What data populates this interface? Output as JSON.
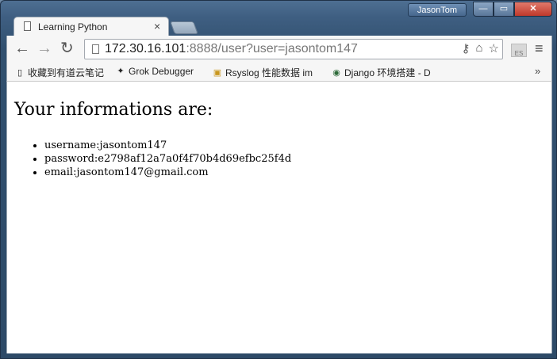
{
  "window": {
    "user_badge": "JasonTom",
    "buttons": {
      "minimize": "—",
      "maximize": "▭",
      "close": "✕"
    }
  },
  "tab": {
    "title": "Learning Python",
    "close": "×"
  },
  "toolbar": {
    "back": "←",
    "forward": "→",
    "reload": "↻",
    "url_host": "172.30.16.101",
    "url_rest": ":8888/user?user=jasontom147",
    "extension_label": "ES",
    "menu": "≡"
  },
  "bookmarks": {
    "items": [
      {
        "label": "收藏到有道云笔记",
        "icon": "document-icon"
      },
      {
        "label": "Grok Debugger",
        "icon": "grok-icon"
      },
      {
        "label": "Rsyslog 性能数据 im",
        "icon": "lock-icon"
      },
      {
        "label": "Django 环境搭建 - D",
        "icon": "django-icon"
      }
    ],
    "more": "»"
  },
  "page": {
    "heading": "Your informations are:",
    "items": [
      "username:jasontom147",
      "password:e2798af12a7a0f4f70b4d69efbc25f4d",
      "email:jasontom147@gmail.com"
    ]
  }
}
